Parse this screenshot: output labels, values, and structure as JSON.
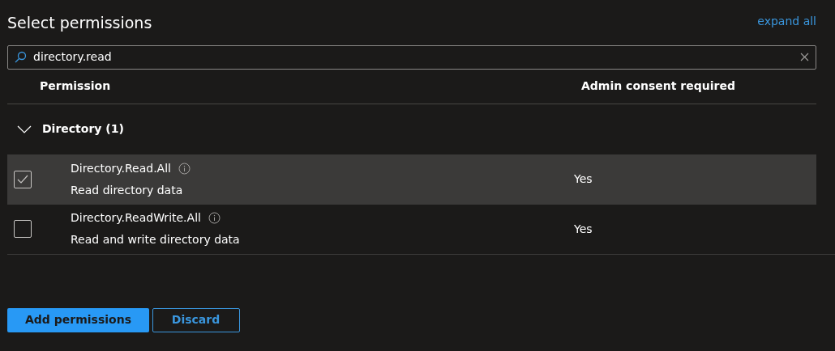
{
  "title": "Select permissions",
  "expand_all": "expand all",
  "search": {
    "value": "directory.read"
  },
  "columns": [
    "Permission",
    "Admin consent required"
  ],
  "groups": [
    {
      "label": "Directory (1)",
      "expanded": true,
      "rows": [
        {
          "name": "Directory.Read.All",
          "description": "Read directory data",
          "admin_consent": "Yes",
          "checked": true,
          "selected": true
        },
        {
          "name": "Directory.ReadWrite.All",
          "description": "Read and write directory data",
          "admin_consent": "Yes",
          "checked": false,
          "selected": false
        }
      ]
    }
  ],
  "buttons": [
    {
      "label": "Add permissions",
      "kind": "primary"
    },
    {
      "label": "Discard",
      "kind": "secondary"
    }
  ]
}
